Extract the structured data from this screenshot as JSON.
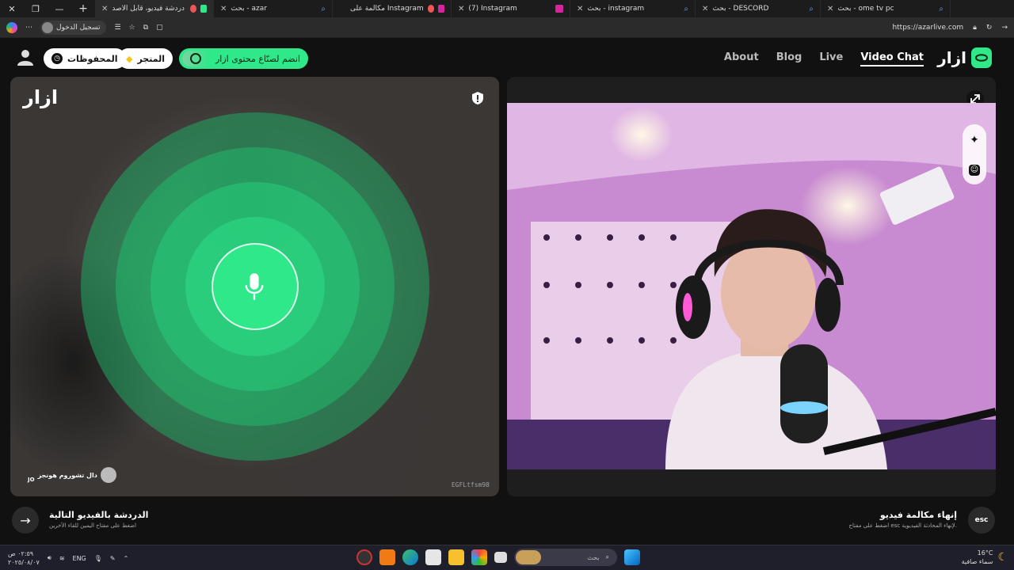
{
  "browser": {
    "tabs": [
      {
        "title": "أزار: دردشة فيديو، قابل الأصد...",
        "active": true
      },
      {
        "title": "بحث - azar",
        "active": false
      },
      {
        "title": "مكالمة على Instagram",
        "active": false
      },
      {
        "title": "(7) Instagram",
        "active": false
      },
      {
        "title": "بحث - instagram",
        "active": false
      },
      {
        "title": "بحث - DESCORD",
        "active": false
      },
      {
        "title": "بحث - ome tv pc",
        "active": false
      }
    ],
    "signin_label": "تسجيل الدخول",
    "url": "https://azarlive.com"
  },
  "header": {
    "saved_label": "المحفوظات",
    "store_label": "المتجر",
    "creator_label": "انضم لصنّاع محتوى ازار",
    "nav": [
      "About",
      "Blog",
      "Live",
      "Video Chat"
    ],
    "nav_active": "Video Chat",
    "logo_text": "ازار"
  },
  "left_panel": {
    "watermark": "ازار",
    "peer_name": "دال تشوروم هونجز",
    "peer_country": "JO",
    "peer_id": "EGFLtfsm98"
  },
  "bottom": {
    "next_title": "الدردشة بالفيديو التالية",
    "next_hint": "اضغط على مفتاح اليمين للقاء الآخرين",
    "esc_label": "esc",
    "end_title": "إنهاء مكالمة فيديو",
    "end_hint": "اضغط على مفتاح esc لإنهاء المحادثة الفيديوية."
  },
  "taskbar": {
    "time": "٠٢:٥٩ ص",
    "date": "٢٠٢٥/٠٨/٠٧",
    "lang": "ENG",
    "search_placeholder": "بحث",
    "temperature": "16°C",
    "weather": "سماء صافية"
  },
  "colors": {
    "accent": "#2ee88a",
    "ring": "#1fbf6e"
  }
}
